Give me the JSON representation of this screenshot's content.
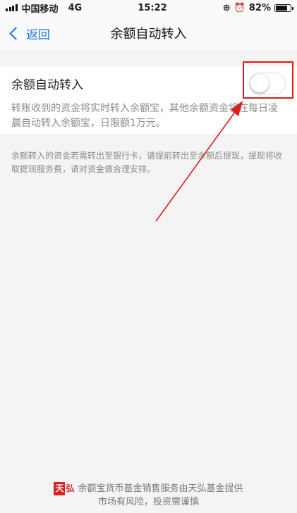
{
  "status": {
    "carrier": "中国移动",
    "network": "4G",
    "time": "15:22",
    "battery": "82%",
    "battery_level": 0.82
  },
  "nav": {
    "back_label": "返回",
    "title": "余额自动转入"
  },
  "setting": {
    "label": "余额自动转入",
    "toggle_on": false,
    "description": "转账收到的资金将实时转入余额宝，其他余额资金将在每日凌晨自动转入余额宝，日限额1万元。"
  },
  "note": "余额转入的资金若需转出至银行卡，请提前转出至余额后提现，提现将收取提现服务费，请对资金做合理安排。",
  "footer": {
    "logo_char1": "天",
    "logo_char2": "弘",
    "line1": "余额宝货币基金销售服务由天弘基金提供",
    "line2": "市场有风险，投资需谨慎"
  },
  "colors": {
    "accent": "#1a73e8",
    "annotation": "#e01b1b"
  }
}
